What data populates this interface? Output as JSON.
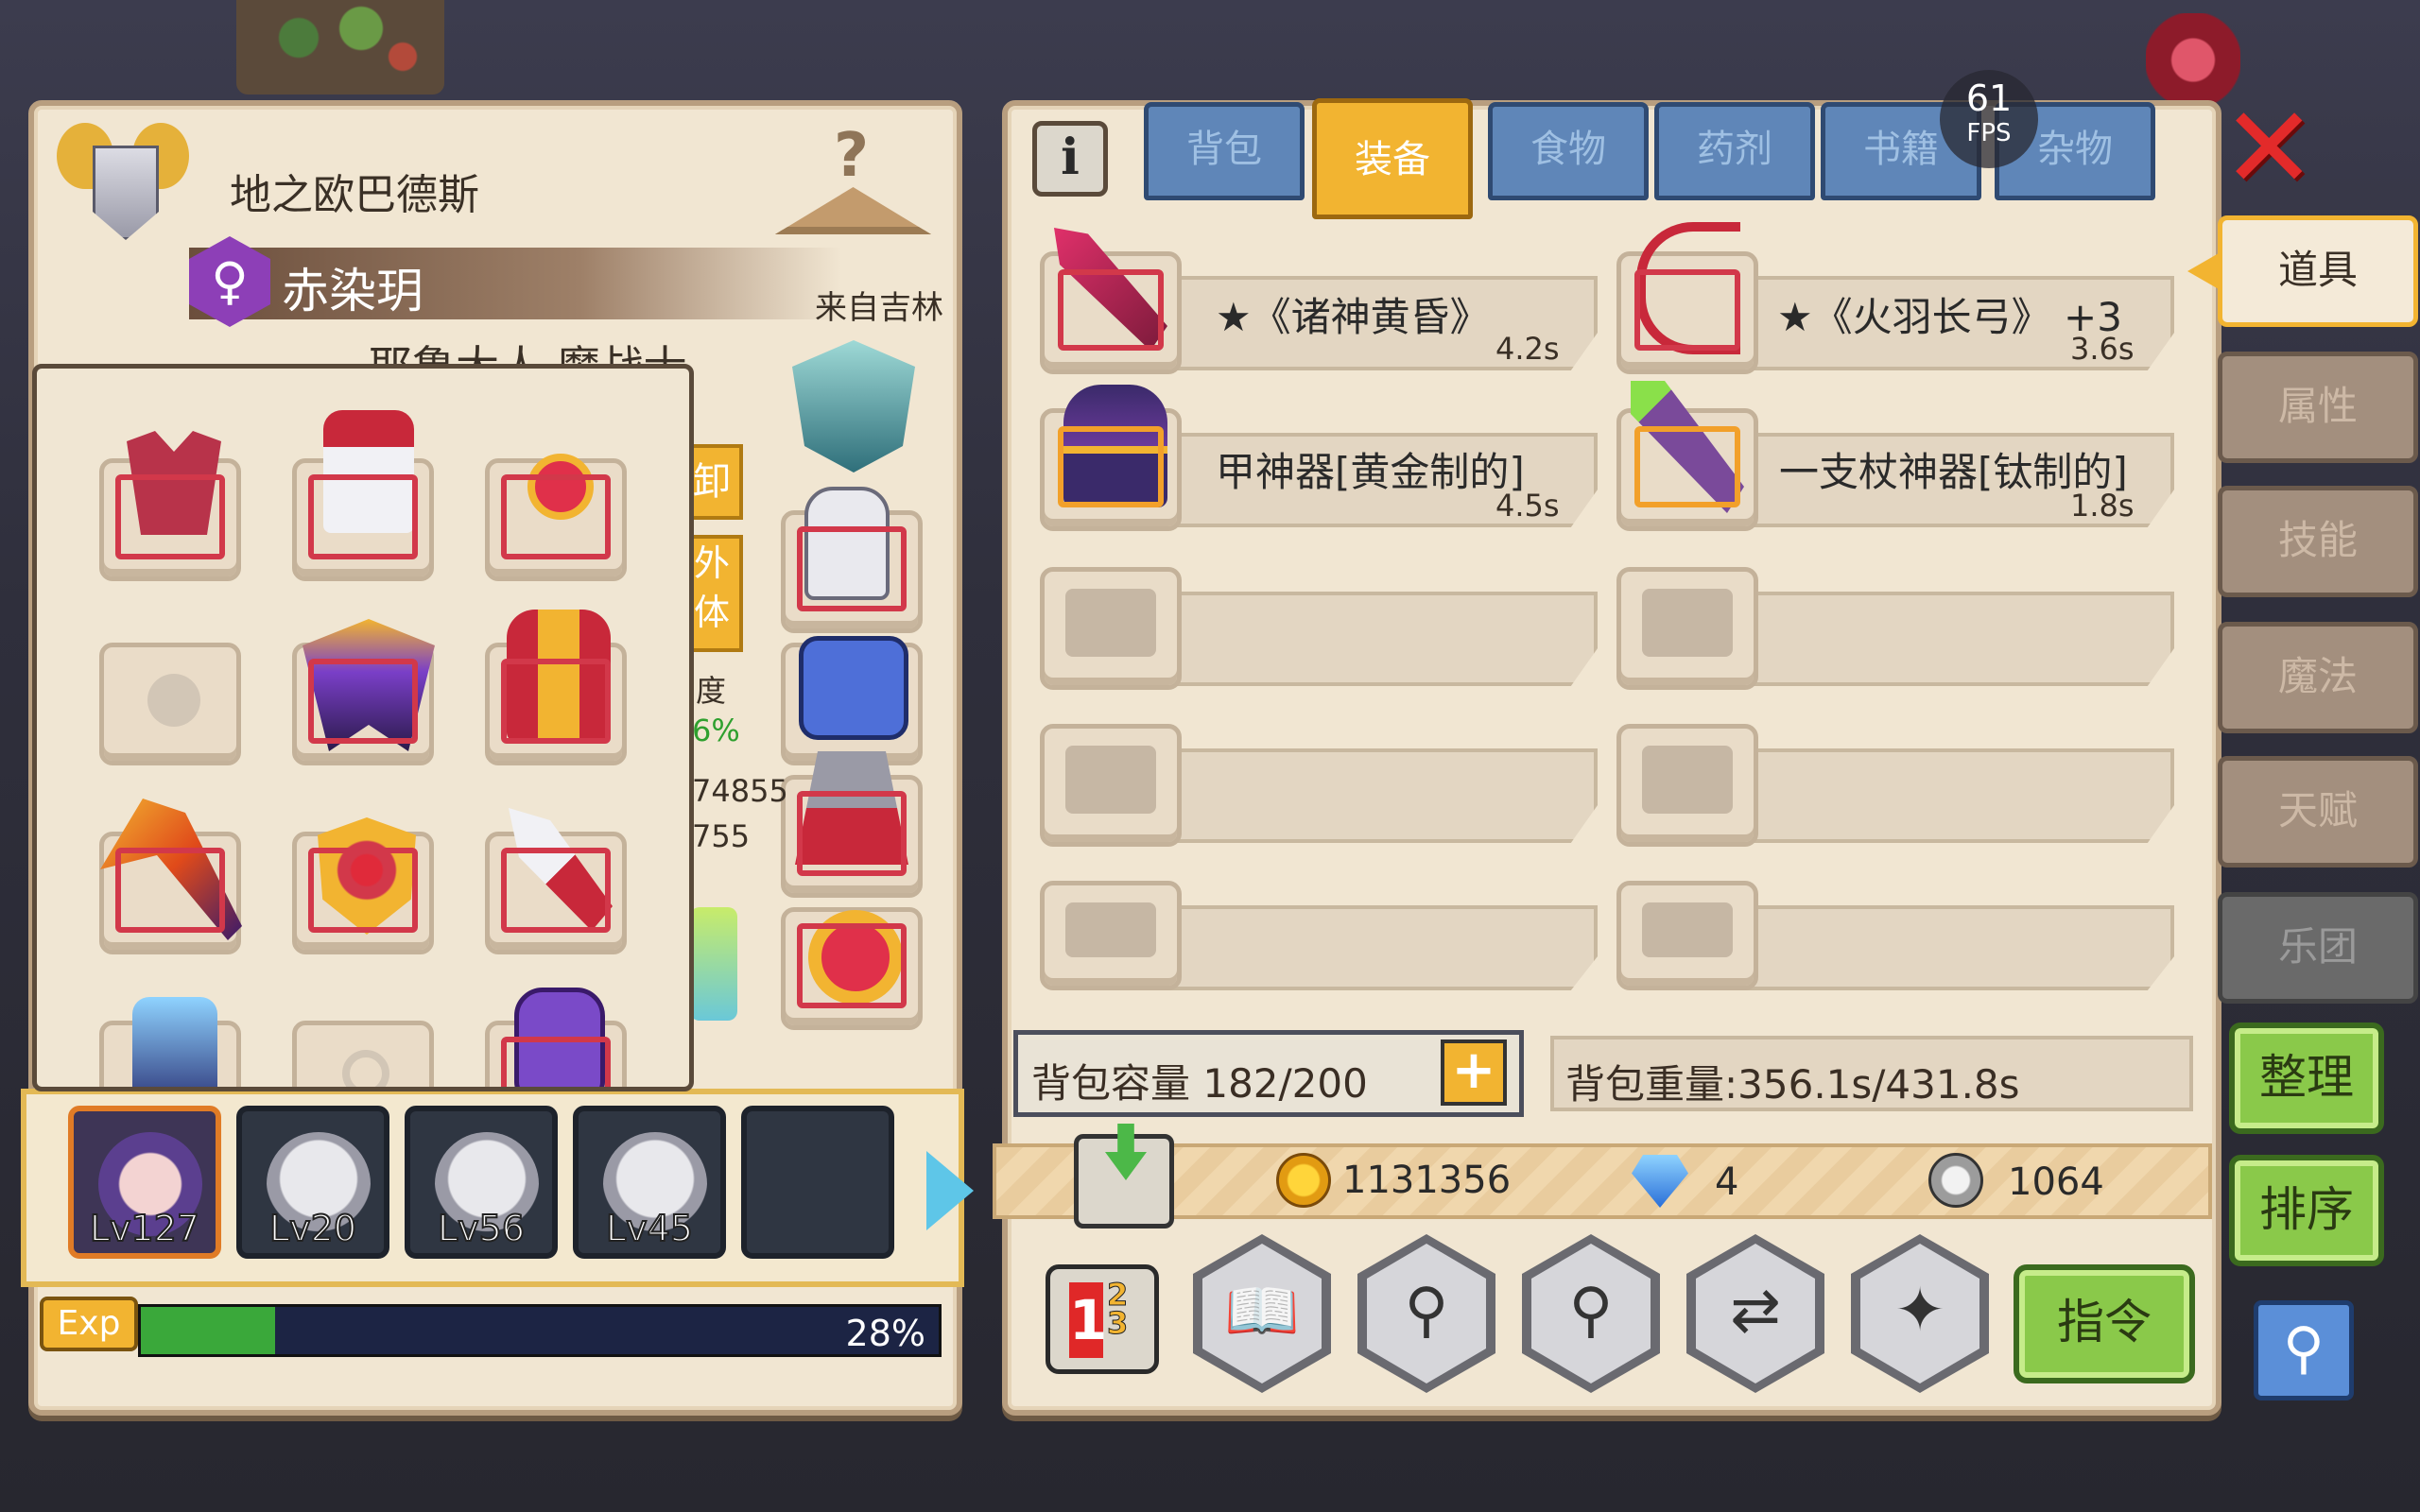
{
  "header": {
    "guild_name": "地之欧巴德斯",
    "character_name": "赤染玥",
    "gender_symbol": "♀",
    "origin": "来自吉林",
    "title_partial": "耶鲁大人 魔战士"
  },
  "left_buttons": {
    "unequip_label": "卸",
    "appearance_label_1": "外",
    "appearance_label_2": "体"
  },
  "stats_partial": {
    "label": "度",
    "percent": "6%",
    "value1": "74855",
    "value2": "755"
  },
  "party": {
    "members": [
      {
        "level": "Lv127",
        "active": true
      },
      {
        "level": "Lv20",
        "active": false
      },
      {
        "level": "Lv56",
        "active": false
      },
      {
        "level": "Lv45",
        "active": false
      }
    ]
  },
  "exp": {
    "label": "Exp",
    "percent_text": "28%",
    "percent": 28
  },
  "fps": {
    "value": "61",
    "label": "FPS"
  },
  "tabs": [
    {
      "label": "背包",
      "active": false
    },
    {
      "label": "装备",
      "active": true
    },
    {
      "label": "食物",
      "active": false
    },
    {
      "label": "药剂",
      "active": false
    },
    {
      "label": "书籍",
      "active": false
    },
    {
      "label": "杂物",
      "active": false
    }
  ],
  "info_icon": "i",
  "items": [
    {
      "name": "★《诸神黄昏》",
      "time": "4.2s"
    },
    {
      "name": "★《火羽长弓》 +3",
      "time": "3.6s"
    },
    {
      "name": "甲神器[黄金制的]",
      "time": "4.5s"
    },
    {
      "name": "一支杖神器[钛制的]",
      "time": "1.8s"
    }
  ],
  "bag": {
    "capacity_label": "背包容量 182/200",
    "plus": "+",
    "weight_label": "背包重量:356.1s/431.8s"
  },
  "currency": {
    "gold": "1131356",
    "diamond": "4",
    "silver": "1064"
  },
  "bottom": {
    "order_n1": "1",
    "order_n23": "2 3",
    "command_label": "指令"
  },
  "side_menu": [
    {
      "label": "道具",
      "active": true
    },
    {
      "label": "属性",
      "active": false
    },
    {
      "label": "技能",
      "active": false
    },
    {
      "label": "魔法",
      "active": false
    },
    {
      "label": "天赋",
      "active": false
    },
    {
      "label": "乐团",
      "active": false
    }
  ],
  "side_buttons": {
    "organize_label": "整理",
    "sort_label": "排序"
  },
  "colors": {
    "accent_gold": "#f2b431",
    "tab_blue": "#5f86b8",
    "rarity_red": "#d2384a",
    "rarity_orange": "#f2a02a",
    "button_green": "#8ac94a"
  }
}
